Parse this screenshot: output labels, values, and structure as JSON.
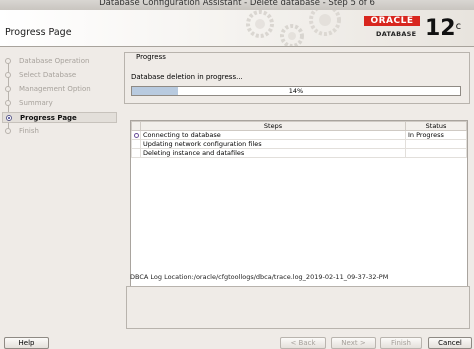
{
  "window": {
    "title": "Database Configuration Assistant - Delete database - Step 5 of 6"
  },
  "header": {
    "page_title": "Progress Page",
    "brand": "ORACLE",
    "brand_sub": "DATABASE",
    "version": "12",
    "version_suffix": "c"
  },
  "sidebar": {
    "items": [
      {
        "label": "Database Operation",
        "state": "done"
      },
      {
        "label": "Select Database",
        "state": "done"
      },
      {
        "label": "Management Option",
        "state": "done"
      },
      {
        "label": "Summary",
        "state": "done"
      },
      {
        "label": "Progress Page",
        "state": "active"
      },
      {
        "label": "Finish",
        "state": "pending"
      }
    ]
  },
  "progress": {
    "group_label": "Progress",
    "status_text": "Database deletion in progress...",
    "percent": 14,
    "percent_label": "14%"
  },
  "steps_table": {
    "headers": {
      "steps": "Steps",
      "status": "Status"
    },
    "rows": [
      {
        "step": "Connecting to database",
        "status": "In Progress",
        "icon": "in-progress-icon"
      },
      {
        "step": "Updating network configuration files",
        "status": ""
      },
      {
        "step": "Deleting instance and datafiles",
        "status": ""
      }
    ]
  },
  "log": {
    "location": "DBCA Log Location:/oracle/cfgtoollogs/dbca/trace.log_2019-02-11_09-37-32-PM"
  },
  "footer": {
    "help": "Help",
    "back": "< Back",
    "next": "Next >",
    "finish": "Finish",
    "cancel": "Cancel"
  }
}
